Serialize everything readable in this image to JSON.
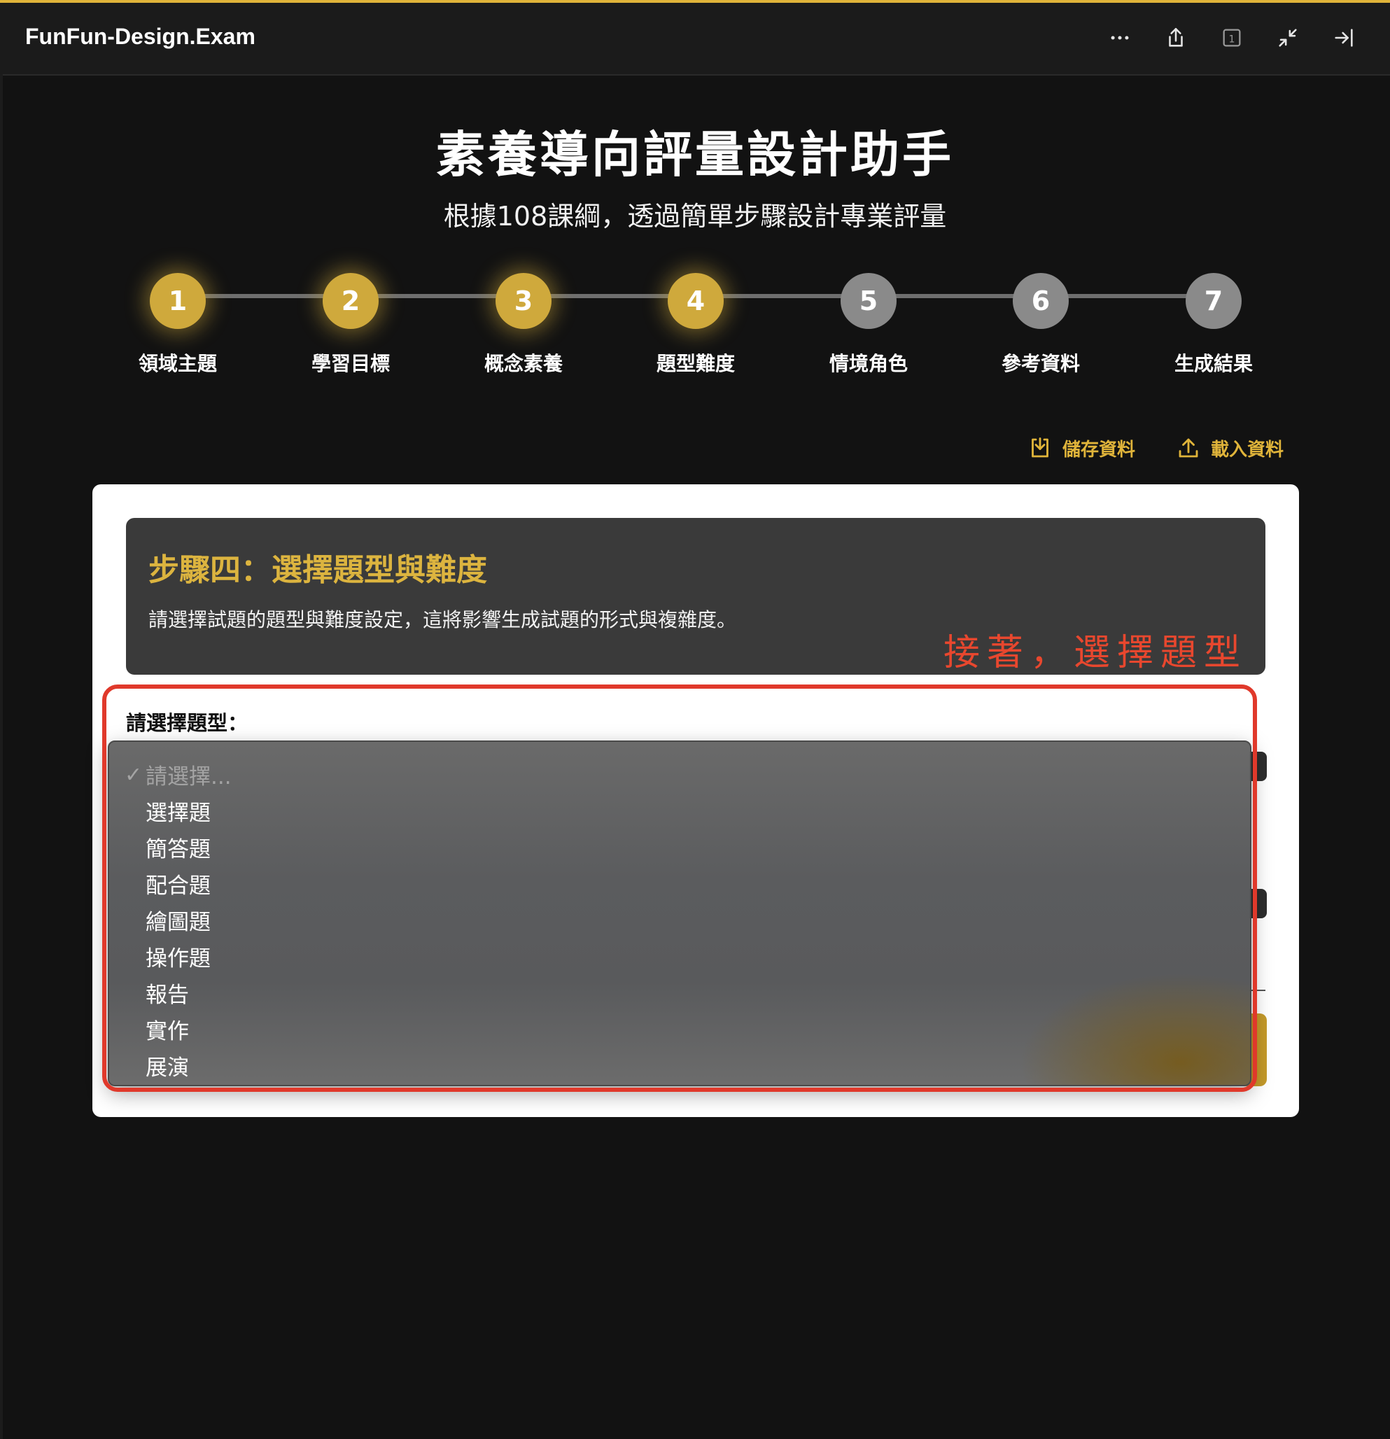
{
  "window": {
    "title": "FunFun-Design.Exam",
    "badge_count": "1"
  },
  "icons": [
    "more-icon",
    "share-icon",
    "tab-count-icon",
    "collapse-icon",
    "sidebar-close-icon",
    "save-download-icon",
    "upload-icon",
    "checkmark-icon"
  ],
  "colors": {
    "accent": "#e0b43a",
    "step_active": "#cfa93c",
    "step_inactive": "#8a8a8a",
    "annotation": "#e0392b",
    "background": "#121212"
  },
  "hero": {
    "title": "素養導向評量設計助手",
    "subtitle": "根據108課綱，透過簡單步驟設計專業評量"
  },
  "steps": [
    {
      "number": "1",
      "label": "領域主題",
      "active": true
    },
    {
      "number": "2",
      "label": "學習目標",
      "active": true
    },
    {
      "number": "3",
      "label": "概念素養",
      "active": true
    },
    {
      "number": "4",
      "label": "題型難度",
      "active": true
    },
    {
      "number": "5",
      "label": "情境角色",
      "active": false
    },
    {
      "number": "6",
      "label": "參考資料",
      "active": false
    },
    {
      "number": "7",
      "label": "生成結果",
      "active": false
    }
  ],
  "actions": {
    "save_label": "儲存資料",
    "load_label": "載入資料"
  },
  "step_header": {
    "title": "步驟四：選擇題型與難度",
    "description": "請選擇試題的題型與難度設定，這將影響生成試題的形式與複雜度。"
  },
  "annotation": {
    "text": "接著，選擇題型"
  },
  "question_type": {
    "label": "請選擇題型：",
    "checkmark": "✓",
    "options": [
      "請選擇...",
      "選擇題",
      "簡答題",
      "配合題",
      "繪圖題",
      "操作題",
      "報告",
      "實作",
      "展演"
    ],
    "selected_index": 0
  }
}
